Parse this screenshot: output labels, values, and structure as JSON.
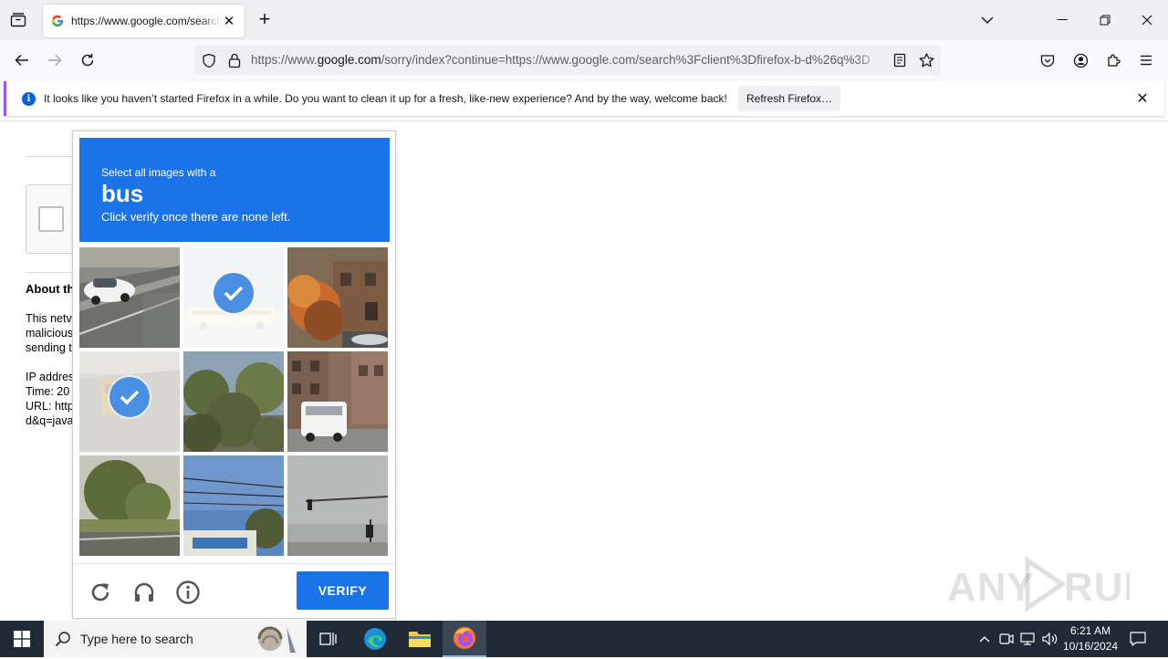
{
  "browser": {
    "tab": {
      "title": "https://www.google.com/search"
    },
    "url": {
      "domain_prefix": "https://www.",
      "domain": "google.com",
      "path": "/sorry/index?continue=https://www.google.com/search%3Fclient%3Dfirefox-b-d%26q%3D"
    }
  },
  "notification": {
    "message": "It looks like you haven’t started Firefox in a while. Do you want to clean it up for a fresh, like-new experience? And by the way, welcome back!",
    "button": "Refresh Firefox…"
  },
  "page": {
    "about_title": "About th",
    "lines": [
      "This netv",
      "malicious",
      "sending t",
      "",
      "IP addres",
      "Time: 20",
      "URL: http",
      "d&q=java"
    ]
  },
  "captcha": {
    "instruction": "Select all images with a",
    "target": "bus",
    "hint": "Click verify once there are none left.",
    "verify_label": "VERIFY",
    "tiles": [
      {
        "subject": "white car on road",
        "selected": false
      },
      {
        "subject": "school bus",
        "selected": true
      },
      {
        "subject": "autumn tree and house",
        "selected": false
      },
      {
        "subject": "yellow bus on highway",
        "selected": true
      },
      {
        "subject": "trees",
        "selected": false
      },
      {
        "subject": "white bus on city street",
        "selected": false
      },
      {
        "subject": "tree and road",
        "selected": false
      },
      {
        "subject": "power lines and building",
        "selected": false
      },
      {
        "subject": "traffic light",
        "selected": false
      }
    ]
  },
  "watermark": "ANY RUN",
  "taskbar": {
    "search_placeholder": "Type here to search",
    "time": "6:21 AM",
    "date": "10/16/2024"
  },
  "colors": {
    "captcha_blue": "#1a73e8",
    "firefox_accent": "#9059ff",
    "taskbar": "#1f2a36"
  }
}
